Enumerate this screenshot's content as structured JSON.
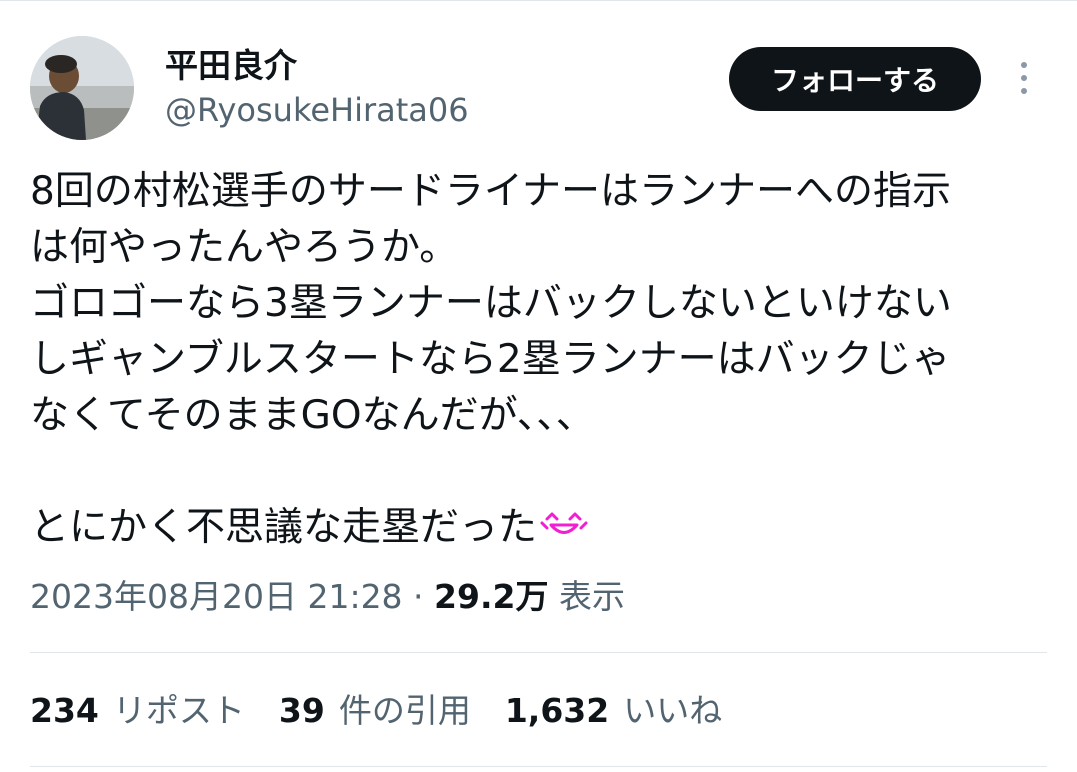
{
  "author": {
    "display_name": "平田良介",
    "handle": "@RyosukeHirata06"
  },
  "actions": {
    "follow_label": "フォローする"
  },
  "tweet": {
    "lines": [
      "8回の村松選手のサードライナーはランナーへの指示",
      "は何やったんやろうか。",
      "ゴロゴーなら3塁ランナーはバックしないといけない",
      "しギャンブルスタートなら2塁ランナーはバックじゃ",
      "なくてそのままGOなんだが、、、",
      "",
      "とにかく不思議な走塁だった"
    ],
    "emoji": "laughing-face-emoji"
  },
  "meta": {
    "timestamp": "2023年08月20日 21:28",
    "separator": " · ",
    "views_count": "29.2万",
    "views_label": "表示"
  },
  "stats": [
    {
      "count": "234",
      "label": "リポスト"
    },
    {
      "count": "39",
      "label": "件の引用"
    },
    {
      "count": "1,632",
      "label": "いいね"
    }
  ],
  "colors": {
    "text": "#0f1419",
    "secondary": "#536471",
    "button_bg": "#0f1419",
    "button_text": "#ffffff",
    "divider": "#e1e6ea",
    "emoji": "#f21fd2"
  }
}
